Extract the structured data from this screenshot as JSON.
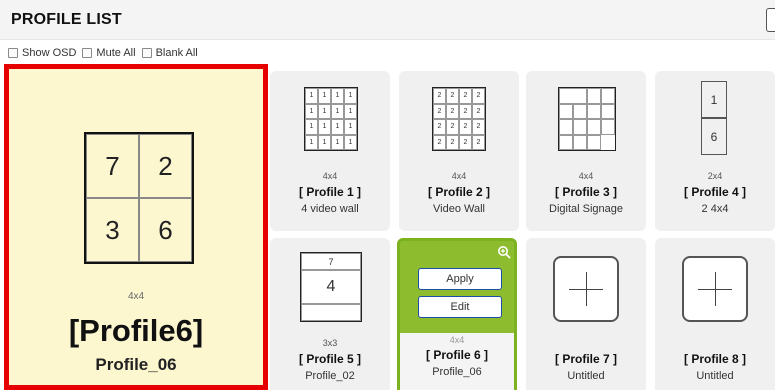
{
  "header": {
    "title": "PROFILE LIST"
  },
  "options": [
    {
      "label": "Show OSD",
      "checked": false
    },
    {
      "label": "Mute All",
      "checked": false
    },
    {
      "label": "Blank All",
      "checked": false
    }
  ],
  "preview": {
    "cells": [
      "7",
      "2",
      "3",
      "6"
    ],
    "dimension": "4x4",
    "name": "[Profile6]",
    "description": "Profile_06"
  },
  "profiles": [
    {
      "dimension": "4x4",
      "name": "[ Profile 1 ]",
      "description": "4 video wall",
      "cells": [
        "1",
        "1",
        "1",
        "1",
        "1",
        "1",
        "1",
        "1",
        "1",
        "1",
        "1",
        "1",
        "1",
        "1",
        "1",
        "1"
      ]
    },
    {
      "dimension": "4x4",
      "name": "[ Profile 2 ]",
      "description": "Video Wall",
      "cells": [
        "2",
        "2",
        "2",
        "2",
        "2",
        "2",
        "2",
        "2",
        "2",
        "2",
        "2",
        "2",
        "2",
        "2",
        "2",
        "2"
      ]
    },
    {
      "dimension": "4x4",
      "name": "[ Profile 3 ]",
      "description": "Digital Signage"
    },
    {
      "dimension": "2x4",
      "name": "[ Profile 4 ]",
      "description": "2 4x4",
      "cells": [
        "1",
        "6"
      ]
    },
    {
      "dimension": "3x3",
      "name": "[ Profile 5 ]",
      "description": "Profile_02",
      "cells": [
        "7",
        "4"
      ]
    },
    {
      "dimension": "4x4",
      "name": "[ Profile 6 ]",
      "description": "Profile_06",
      "apply_label": "Apply",
      "edit_label": "Edit"
    },
    {
      "name": "[ Profile 7 ]",
      "description": "Untitled"
    },
    {
      "name": "[ Profile 8 ]",
      "description": "Untitled"
    }
  ],
  "colors": {
    "selection_border": "#e60000",
    "active_card": "#8dbd2e",
    "preview_bg": "#fdf7d0"
  }
}
